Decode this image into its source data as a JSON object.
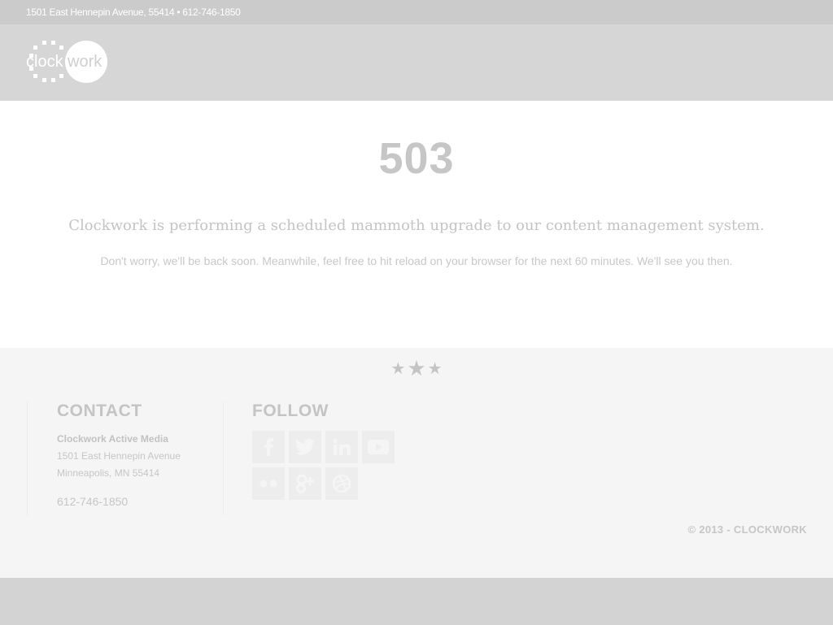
{
  "topbar": {
    "address_line": "1501 East Hennepin Avenue, 55414 • 612-746-1850"
  },
  "header": {
    "logo": {
      "left": "clock",
      "right": "work"
    }
  },
  "main": {
    "code": "503",
    "headline": "Clockwork is performing a scheduled mammoth upgrade to our content management system.",
    "message": "Don't worry, we'll be back soon. Meanwhile, feel free to hit reload on your browser for the next 60 minutes. We'll see you then."
  },
  "footer": {
    "stars": [
      "★",
      "★",
      "★"
    ],
    "contact": {
      "title": "CONTACT",
      "company": "Clockwork Active Media",
      "street": "1501 East Hennepin Avenue",
      "city": "Minneapolis, MN 55414",
      "phone": "612-746-1850"
    },
    "follow": {
      "title": "FOLLOW",
      "icons": [
        "facebook-icon",
        "twitter-icon",
        "linkedin-icon",
        "youtube-icon",
        "flickr-icon",
        "google-plus-icon",
        "dribbble-icon"
      ]
    },
    "copyright": "© 2013 - CLOCKWORK"
  },
  "colors": {
    "topbar_bg": "#cbcbcb",
    "header_bg": "#d6d6d6",
    "main_bg": "#ffffff",
    "footer_bg": "#f5f5f5",
    "text_gray": "#c4c4c4"
  }
}
